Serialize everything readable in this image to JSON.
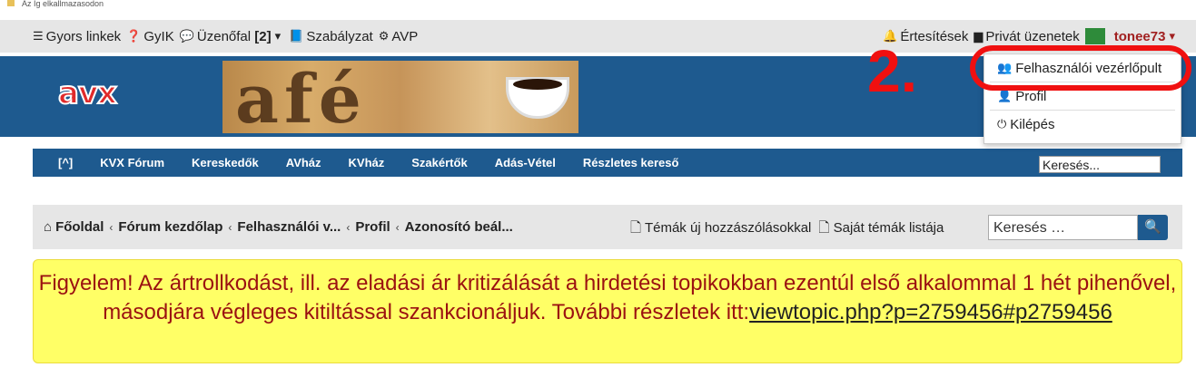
{
  "tabstrip": {
    "title": "Az Ig elkallmazasodon"
  },
  "topnav": {
    "items": [
      {
        "icon": "menu-icon",
        "label": "Gyors linkek"
      },
      {
        "icon": "question-icon",
        "label": "GyIK"
      },
      {
        "icon": "comments-icon",
        "label": "Üzenőfal"
      },
      {
        "icon": "book-icon",
        "label": "Szabályzat"
      },
      {
        "icon": "cogs-icon",
        "label": "AVP"
      }
    ],
    "wall_count": "[2]",
    "notifications": "Értesítések",
    "private_messages": "Privát üzenetek",
    "username": "tonee73"
  },
  "banner": {
    "logo": "avx",
    "cafe_text": "afé"
  },
  "categories": [
    "[^]",
    "KVX Fórum",
    "Kereskedők",
    "AVház",
    "KVház",
    "Szakértők",
    "Adás-Vétel",
    "Részletes kereső"
  ],
  "cat_search_value": "Keresés...",
  "breadcrumb": [
    "Főoldal",
    "Fórum kezdőlap",
    "Felhasználói v...",
    "Profil",
    "Azonosító beál..."
  ],
  "crumb_links": [
    "Témák új hozzászólásokkal",
    "Saját témák listája"
  ],
  "crumb_search_placeholder": "Keresés …",
  "notice": {
    "text": "Figyelem! Az ártrollkodást, ill. az eladási ár kritizálását a hirdetési topikokban ezentúl első alkalommal 1 hét pihenővel, másodjára végleges kitiltással szankcionáljuk. További részletek itt:",
    "link": "viewtopic.php?p=2759456#p2759456"
  },
  "dropdown": [
    {
      "icon": "users-icon",
      "label": "Felhasználói vezérlőpult"
    },
    {
      "icon": "user-icon",
      "label": "Profil"
    },
    {
      "icon": "power-icon",
      "label": "Kilépés"
    }
  ],
  "annotation": "2."
}
